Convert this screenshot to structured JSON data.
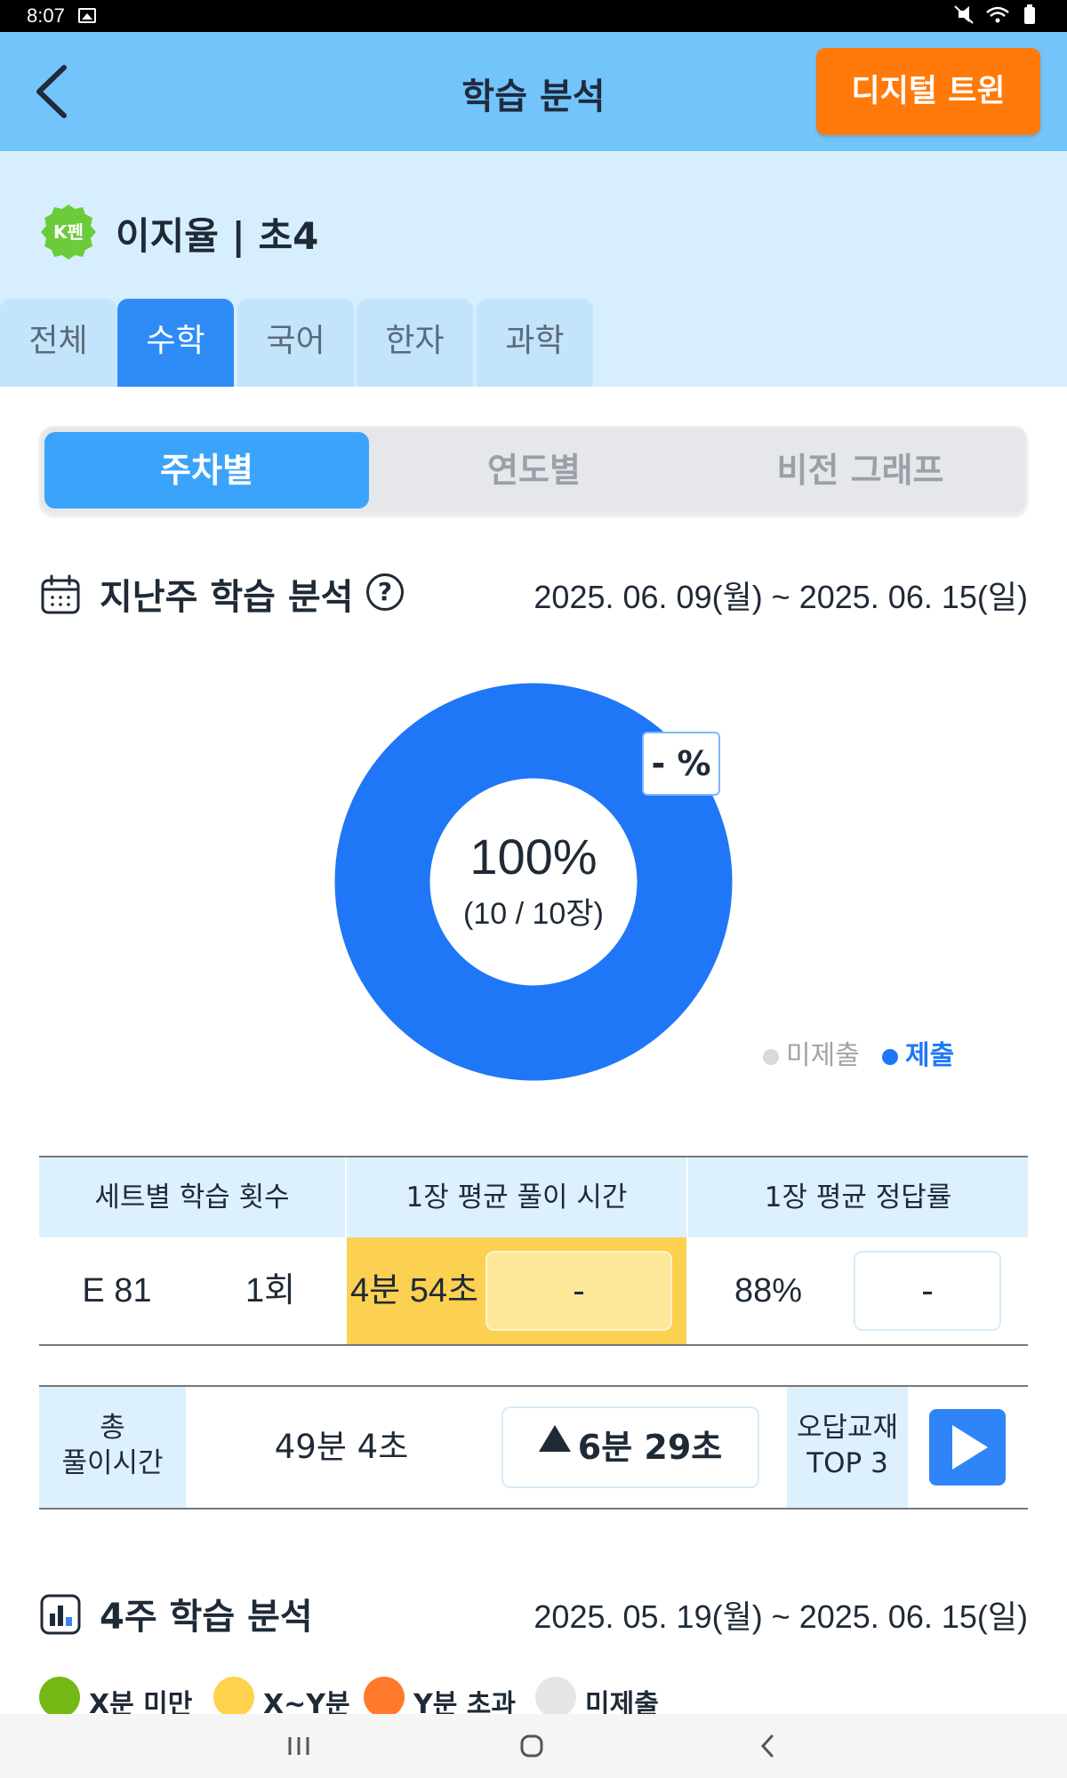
{
  "status_bar": {
    "time": "8:07"
  },
  "app_bar": {
    "title": "학습 분석",
    "twin_button": "디지털 트윈"
  },
  "profile": {
    "badge": "K펜",
    "name": "이지율 | 초4"
  },
  "subject_tabs": [
    "전체",
    "수학",
    "국어",
    "한자",
    "과학"
  ],
  "active_subject": "수학",
  "view_tabs": [
    "주차별",
    "연도별",
    "비전 그래프"
  ],
  "last_week": {
    "title": "지난주 학습 분석",
    "help": "?",
    "date_range": "2025. 06. 09(월) ~ 2025. 06. 15(일)",
    "percent": "100%",
    "count": "(10 / 10장)",
    "delta_label": "- %",
    "legend": {
      "unsubmitted": "미제출",
      "submitted": "제출"
    },
    "submitted_fraction": 1.0
  },
  "stats": {
    "headers": [
      "세트별 학습 횟수",
      "1장 평균 풀이 시간",
      "1장 평균 정답률"
    ],
    "set_name": "E 81",
    "set_count": "1회",
    "avg_time": "4분 54초",
    "avg_time_compare": "-",
    "accuracy": "88%",
    "accuracy_compare": "-"
  },
  "total": {
    "label_line1": "총",
    "label_line2": "풀이시간",
    "value": "49분 4초",
    "diff": "6분 29초",
    "top3_line1": "오답교재",
    "top3_line2": "TOP 3"
  },
  "four_week": {
    "title": "4주 학습 분석",
    "date_range": "2025. 05. 19(월) ~ 2025. 06. 15(일)",
    "legend": [
      "X분 미만",
      "X~Y분",
      "Y분 초과",
      "미제출"
    ]
  },
  "colors": {
    "app_bar": "#72c4fb",
    "accent_orange": "#ff7a0a",
    "primary_blue": "#2f8cf7",
    "donut_blue": "#1f77f7",
    "legend_green": "#74b816",
    "legend_yellow": "#ffd24d",
    "legend_orange": "#ff7a2b",
    "legend_gray": "#e6e6e6"
  }
}
